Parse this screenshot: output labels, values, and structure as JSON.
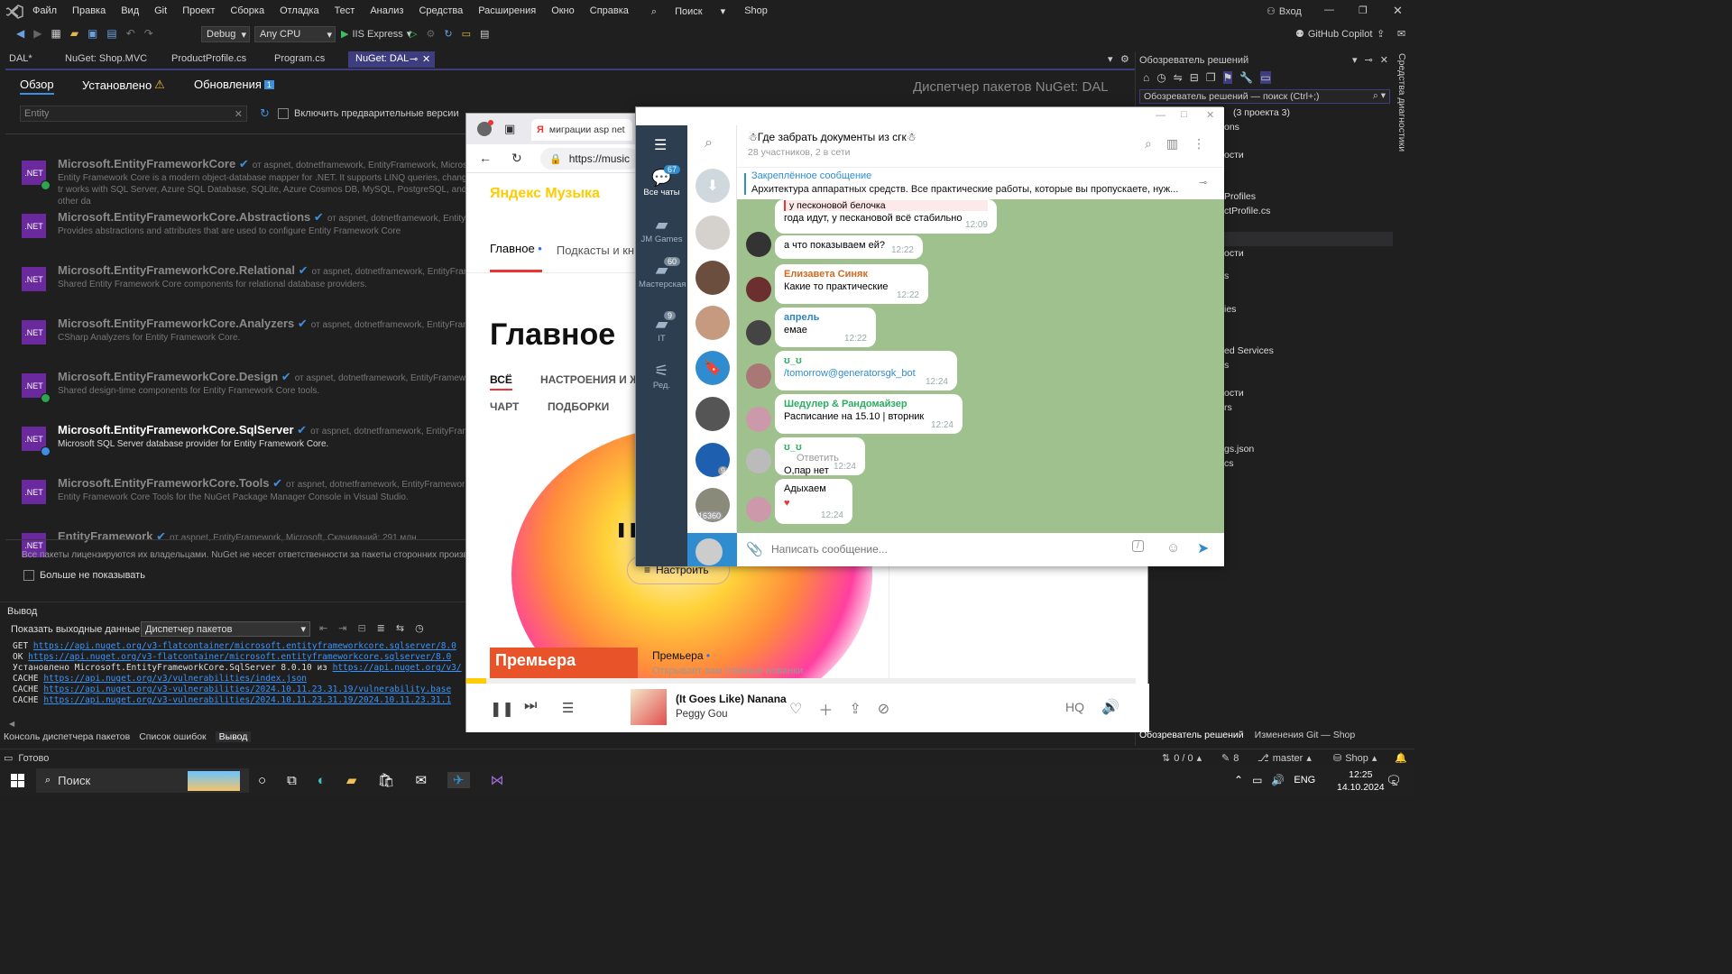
{
  "vs": {
    "menu": [
      "Файл",
      "Правка",
      "Вид",
      "Git",
      "Проект",
      "Сборка",
      "Отладка",
      "Тест",
      "Анализ",
      "Средства",
      "Расширения",
      "Окно",
      "Справка"
    ],
    "search_label": "Поиск",
    "solution_name": "Shop",
    "signin": "Вход",
    "copilot": "GitHub Copilot",
    "config": "Debug",
    "platform": "Any CPU",
    "run_target": "IIS Express",
    "doc_tabs": [
      "DAL*",
      "NuGet: Shop.MVC",
      "ProductProfile.cs",
      "Program.cs",
      "NuGet: DAL"
    ],
    "nuget": {
      "tabs": [
        "Обзор",
        "Установлено",
        "Обновления"
      ],
      "updates_count": "1",
      "title": "Диспетчер пакетов NuGet: DAL",
      "search_value": "Entity",
      "prerelease_label": "Включить предварительные версии",
      "packages": [
        {
          "name": "Microsoft.EntityFrameworkCore",
          "by": "от aspnet, dotnetframework, EntityFramework, Microsoft,",
          "desc": "Entity Framework Core is a modern object-database mapper for .NET. It supports LINQ queries, change tr works with SQL Server, Azure SQL Database, SQLite, Azure Cosmos DB, MySQL, PostgreSQL, and other da",
          "badge": "check"
        },
        {
          "name": "Microsoft.EntityFrameworkCore.Abstractions",
          "by": "от aspnet, dotnetframework, EntityFram",
          "desc": "Provides abstractions and attributes that are used to configure Entity Framework Core",
          "badge": ""
        },
        {
          "name": "Microsoft.EntityFrameworkCore.Relational",
          "by": "от aspnet, dotnetframework, EntityFramew",
          "desc": "Shared Entity Framework Core components for relational database providers.",
          "badge": ""
        },
        {
          "name": "Microsoft.EntityFrameworkCore.Analyzers",
          "by": "от aspnet, dotnetframework, EntityFramew",
          "desc": "CSharp Analyzers for Entity Framework Core.",
          "badge": ""
        },
        {
          "name": "Microsoft.EntityFrameworkCore.Design",
          "by": "от aspnet, dotnetframework, EntityFramework, Mi",
          "desc": "Shared design-time components for Entity Framework Core tools.",
          "badge": "check"
        },
        {
          "name": "Microsoft.EntityFrameworkCore.SqlServer",
          "by": "от aspnet, dotnetframework, EntityFramewo",
          "desc": "Microsoft SQL Server database provider for Entity Framework Core.",
          "badge": "up"
        },
        {
          "name": "Microsoft.EntityFrameworkCore.Tools",
          "by": "от aspnet, dotnetframework, EntityFramework, Mic",
          "desc": "Entity Framework Core Tools for the NuGet Package Manager Console in Visual Studio.",
          "badge": ""
        },
        {
          "name": "EntityFramework",
          "by": "от aspnet, EntityFramework, Microsoft, Скачиваний: 291 млн",
          "desc": "",
          "badge": ""
        }
      ],
      "license_note": "Все пакеты лицензируются их владельцами. NuGet не несет ответственности за пакеты сторонних производ",
      "dont_show": "Больше не показывать"
    },
    "output": {
      "title": "Вывод",
      "show_label": "Показать выходные данные из:",
      "source": "Диспетчер пакетов",
      "lines": [
        {
          "pre": "GET ",
          "url": "https://api.nuget.org/v3-flatcontainer/microsoft.entityframeworkcore.sqlserver/8.0"
        },
        {
          "pre": "OK ",
          "url": "https://api.nuget.org/v3-flatcontainer/microsoft.entityframeworkcore.sqlserver/8.0"
        },
        {
          "pre": "Установлено Microsoft.EntityFrameworkCore.SqlServer 8.0.10 из ",
          "url": "https://api.nuget.org/v3/"
        },
        {
          "pre": "CACHE ",
          "url": "https://api.nuget.org/v3/vulnerabilities/index.json"
        },
        {
          "pre": "CACHE ",
          "url": "https://api.nuget.org/v3-vulnerabilities/2024.10.11.23.31.19/vulnerability.base"
        },
        {
          "pre": "CACHE ",
          "url": "https://api.nuget.org/v3-vulnerabilities/2024.10.11.23.31.19/2024.10.11.23.31.1"
        }
      ],
      "tabs": [
        "Консоль диспетчера пакетов",
        "Список ошибок",
        "Вывод"
      ]
    },
    "solution_explorer": {
      "title": "Обозреватель решений",
      "search_placeholder": "Обозреватель решений — поиск (Ctrl+;)",
      "items": [
        "(3 проекта 3)",
        "ons",
        "ости",
        "Profiles",
        "ctProfile.cs",
        "ости",
        "s",
        "ies",
        "ed Services",
        "s",
        "ости",
        "rs",
        "gs.json",
        "cs"
      ],
      "bottom_tabs": [
        "Обозреватель решений",
        "Изменения Git — Shop"
      ]
    },
    "side_label": "Средства диагностики",
    "status": {
      "ready": "Готово",
      "lines": "0 / 0",
      "edits": "8",
      "branch": "master",
      "repo": "Shop"
    }
  },
  "browser": {
    "tab_title": "миграции asp net",
    "url": "https://music",
    "logo": "Яндекс Музыка",
    "nav": [
      "Главное",
      "Подкасты и кни"
    ],
    "heading": "Главное",
    "filters": [
      "ВСЁ",
      "НАСТРОЕНИЯ И Ж",
      "ЧАРТ",
      "ПОДБОРКИ"
    ],
    "configure": "Настроить",
    "premiere_banner": "Премьера",
    "premiere_title": "Премьера",
    "premiere_sub": "Открывает вам главные новинки",
    "track": "(It Goes Like) Nanana",
    "artist": "Peggy Gou",
    "hq": "HQ"
  },
  "telegram": {
    "folders": [
      {
        "label": "Все чаты",
        "count": "67"
      },
      {
        "label": "JM Games",
        "count": ""
      },
      {
        "label": "Мастерская",
        "count": "60"
      },
      {
        "label": "IT",
        "count": "9"
      },
      {
        "label": "Ред.",
        "count": ""
      }
    ],
    "chat_badges": [
      "9",
      "16360"
    ],
    "chat_title": "Где забрать документы из сгк",
    "chat_sub": "28 участников, 2 в сети",
    "pinned_label": "Закреплённое сообщение",
    "pinned_text": "Архитектура аппаратных средств. Все практические работы, которые вы пропускаете, нуж...",
    "messages": [
      {
        "name": "",
        "reply": "у песконовой белочка",
        "text": "года идут, у пескановой всё стабильно",
        "time": "12:09"
      },
      {
        "name": "",
        "reply": "",
        "text": "а что показываем ей?",
        "time": "12:22"
      },
      {
        "name": "Елизавета Синяк",
        "reply": "",
        "text": "Какие то практические",
        "time": "12:22",
        "color": "#d2691e"
      },
      {
        "name": "апрель",
        "reply": "",
        "text": "емае",
        "time": "12:22",
        "color": "#2e86c1"
      },
      {
        "name": "ʊ_ʊ",
        "reply": "",
        "text": "/tomorrow@generatorsgk_bot",
        "time": "12:24",
        "color": "#27ae60",
        "link": true
      },
      {
        "name": "Шедулер & Рандомайзер",
        "reply": "",
        "text": "Расписание на 15.10 | вторник",
        "time": "12:24",
        "color": "#27ae60"
      },
      {
        "name": "ʊ_ʊ",
        "reply": "",
        "text": "О,пар нет",
        "time": "12:24",
        "color": "#27ae60",
        "extra": "Ответить"
      },
      {
        "name": "",
        "reply": "",
        "text": "Адыхаем",
        "time": "12:24"
      }
    ],
    "input_placeholder": "Написать сообщение..."
  },
  "taskbar": {
    "search": "Поиск",
    "lang": "ENG",
    "time": "12:25",
    "date": "14.10.2024",
    "notif": "5"
  },
  "colors": {
    "vs_accent": "#3d3d80",
    "tg_blue": "#2f8dcf",
    "ym_yellow": "#ffcc00"
  }
}
